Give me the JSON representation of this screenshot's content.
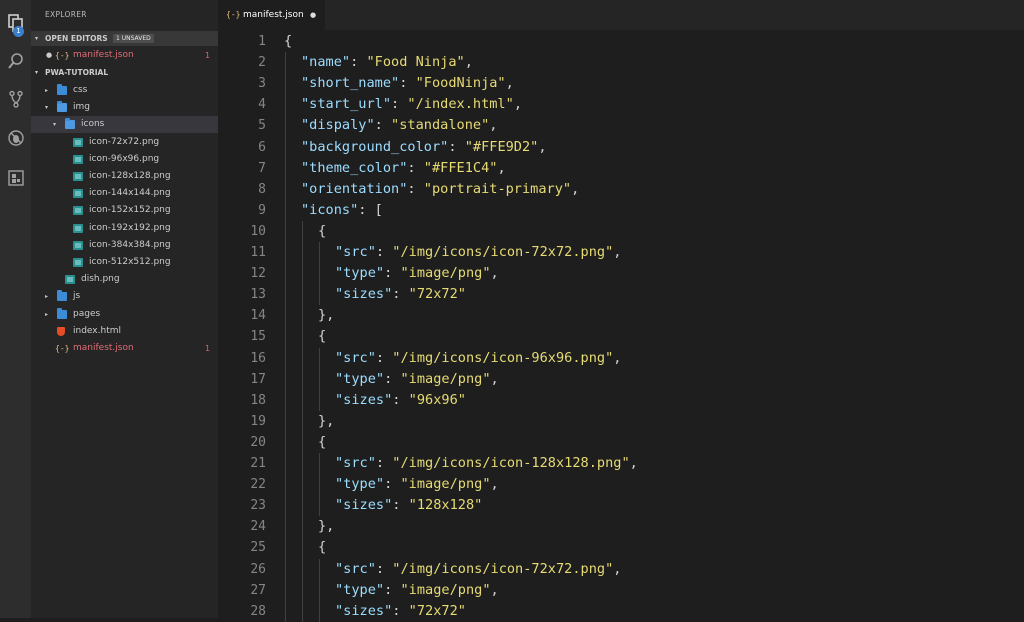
{
  "explorer": {
    "title": "EXPLORER",
    "open_editors": {
      "label": "OPEN EDITORS",
      "badge": "1 UNSAVED",
      "items": [
        {
          "label": "manifest.json",
          "count": "1"
        }
      ]
    },
    "project": {
      "label": "PWA-TUTORIAL",
      "tree": [
        {
          "label": "css",
          "type": "folder",
          "depth": 1,
          "open": false
        },
        {
          "label": "img",
          "type": "folder",
          "depth": 1,
          "open": true
        },
        {
          "label": "icons",
          "type": "folder",
          "depth": 2,
          "open": true,
          "selected": true
        },
        {
          "label": "icon-72x72.png",
          "type": "image",
          "depth": 3
        },
        {
          "label": "icon-96x96.png",
          "type": "image",
          "depth": 3
        },
        {
          "label": "icon-128x128.png",
          "type": "image",
          "depth": 3
        },
        {
          "label": "icon-144x144.png",
          "type": "image",
          "depth": 3
        },
        {
          "label": "icon-152x152.png",
          "type": "image",
          "depth": 3
        },
        {
          "label": "icon-192x192.png",
          "type": "image",
          "depth": 3
        },
        {
          "label": "icon-384x384.png",
          "type": "image",
          "depth": 3
        },
        {
          "label": "icon-512x512.png",
          "type": "image",
          "depth": 3
        },
        {
          "label": "dish.png",
          "type": "image",
          "depth": 2
        },
        {
          "label": "js",
          "type": "folder",
          "depth": 1,
          "open": false
        },
        {
          "label": "pages",
          "type": "folder",
          "depth": 1,
          "open": false
        },
        {
          "label": "index.html",
          "type": "html",
          "depth": 1
        },
        {
          "label": "manifest.json",
          "type": "json",
          "depth": 1,
          "modified": true,
          "count": "1"
        }
      ]
    }
  },
  "activity_bar": {
    "items": [
      "files-icon",
      "search-icon",
      "source-control-icon",
      "debug-icon",
      "extensions-icon"
    ],
    "badge": "1"
  },
  "tab": {
    "label": "manifest.json",
    "icon": "{-}"
  },
  "editor": {
    "line_numbers": [
      "1",
      "2",
      "3",
      "4",
      "5",
      "6",
      "7",
      "8",
      "9",
      "10",
      "11",
      "12",
      "13",
      "14",
      "15",
      "16",
      "17",
      "18",
      "19",
      "20",
      "21",
      "22",
      "23",
      "24",
      "25",
      "26",
      "27",
      "28"
    ],
    "lines": [
      {
        "indent": 0,
        "tokens": [
          {
            "t": "p",
            "v": "{"
          }
        ]
      },
      {
        "indent": 1,
        "tokens": [
          {
            "t": "k",
            "v": "\"name\""
          },
          {
            "t": "p",
            "v": ": "
          },
          {
            "t": "v",
            "v": "\"Food Ninja\""
          },
          {
            "t": "p",
            "v": ","
          }
        ]
      },
      {
        "indent": 1,
        "tokens": [
          {
            "t": "k",
            "v": "\"short_name\""
          },
          {
            "t": "p",
            "v": ": "
          },
          {
            "t": "v",
            "v": "\"FoodNinja\""
          },
          {
            "t": "p",
            "v": ","
          }
        ]
      },
      {
        "indent": 1,
        "tokens": [
          {
            "t": "k",
            "v": "\"start_url\""
          },
          {
            "t": "p",
            "v": ": "
          },
          {
            "t": "v",
            "v": "\"/index.html\""
          },
          {
            "t": "p",
            "v": ","
          }
        ]
      },
      {
        "indent": 1,
        "tokens": [
          {
            "t": "k",
            "v": "\"dispaly\""
          },
          {
            "t": "p",
            "v": ": "
          },
          {
            "t": "v",
            "v": "\"standalone\""
          },
          {
            "t": "p",
            "v": ","
          }
        ]
      },
      {
        "indent": 1,
        "tokens": [
          {
            "t": "k",
            "v": "\"background_color\""
          },
          {
            "t": "p",
            "v": ": "
          },
          {
            "t": "v",
            "v": "\"#FFE9D2\""
          },
          {
            "t": "p",
            "v": ","
          }
        ]
      },
      {
        "indent": 1,
        "tokens": [
          {
            "t": "k",
            "v": "\"theme_color\""
          },
          {
            "t": "p",
            "v": ": "
          },
          {
            "t": "v",
            "v": "\"#FFE1C4\""
          },
          {
            "t": "p",
            "v": ","
          }
        ]
      },
      {
        "indent": 1,
        "tokens": [
          {
            "t": "k",
            "v": "\"orientation\""
          },
          {
            "t": "p",
            "v": ": "
          },
          {
            "t": "v",
            "v": "\"portrait-primary\""
          },
          {
            "t": "p",
            "v": ","
          }
        ]
      },
      {
        "indent": 1,
        "tokens": [
          {
            "t": "k",
            "v": "\"icons\""
          },
          {
            "t": "p",
            "v": ": ["
          }
        ]
      },
      {
        "indent": 2,
        "tokens": [
          {
            "t": "p",
            "v": "{"
          }
        ]
      },
      {
        "indent": 3,
        "tokens": [
          {
            "t": "k",
            "v": "\"src\""
          },
          {
            "t": "p",
            "v": ": "
          },
          {
            "t": "v",
            "v": "\"/img/icons/icon-72x72.png\""
          },
          {
            "t": "p",
            "v": ","
          }
        ]
      },
      {
        "indent": 3,
        "tokens": [
          {
            "t": "k",
            "v": "\"type\""
          },
          {
            "t": "p",
            "v": ": "
          },
          {
            "t": "v",
            "v": "\"image/png\""
          },
          {
            "t": "p",
            "v": ","
          }
        ]
      },
      {
        "indent": 3,
        "tokens": [
          {
            "t": "k",
            "v": "\"sizes\""
          },
          {
            "t": "p",
            "v": ": "
          },
          {
            "t": "v",
            "v": "\"72x72\""
          }
        ]
      },
      {
        "indent": 2,
        "tokens": [
          {
            "t": "p",
            "v": "},"
          }
        ]
      },
      {
        "indent": 2,
        "tokens": [
          {
            "t": "p",
            "v": "{"
          }
        ]
      },
      {
        "indent": 3,
        "tokens": [
          {
            "t": "k",
            "v": "\"src\""
          },
          {
            "t": "p",
            "v": ": "
          },
          {
            "t": "v",
            "v": "\"/img/icons/icon-96x96.png\""
          },
          {
            "t": "p",
            "v": ","
          }
        ]
      },
      {
        "indent": 3,
        "tokens": [
          {
            "t": "k",
            "v": "\"type\""
          },
          {
            "t": "p",
            "v": ": "
          },
          {
            "t": "v",
            "v": "\"image/png\""
          },
          {
            "t": "p",
            "v": ","
          }
        ]
      },
      {
        "indent": 3,
        "tokens": [
          {
            "t": "k",
            "v": "\"sizes\""
          },
          {
            "t": "p",
            "v": ": "
          },
          {
            "t": "v",
            "v": "\"96x96\""
          }
        ]
      },
      {
        "indent": 2,
        "tokens": [
          {
            "t": "p",
            "v": "},"
          }
        ]
      },
      {
        "indent": 2,
        "tokens": [
          {
            "t": "p",
            "v": "{"
          }
        ]
      },
      {
        "indent": 3,
        "tokens": [
          {
            "t": "k",
            "v": "\"src\""
          },
          {
            "t": "p",
            "v": ": "
          },
          {
            "t": "v",
            "v": "\"/img/icons/icon-128x128.png\""
          },
          {
            "t": "p",
            "v": ","
          }
        ]
      },
      {
        "indent": 3,
        "tokens": [
          {
            "t": "k",
            "v": "\"type\""
          },
          {
            "t": "p",
            "v": ": "
          },
          {
            "t": "v",
            "v": "\"image/png\""
          },
          {
            "t": "p",
            "v": ","
          }
        ]
      },
      {
        "indent": 3,
        "tokens": [
          {
            "t": "k",
            "v": "\"sizes\""
          },
          {
            "t": "p",
            "v": ": "
          },
          {
            "t": "v",
            "v": "\"128x128\""
          }
        ]
      },
      {
        "indent": 2,
        "tokens": [
          {
            "t": "p",
            "v": "},"
          }
        ]
      },
      {
        "indent": 2,
        "tokens": [
          {
            "t": "p",
            "v": "{"
          }
        ]
      },
      {
        "indent": 3,
        "tokens": [
          {
            "t": "k",
            "v": "\"src\""
          },
          {
            "t": "p",
            "v": ": "
          },
          {
            "t": "v",
            "v": "\"/img/icons/icon-72x72.png\""
          },
          {
            "t": "p",
            "v": ","
          }
        ]
      },
      {
        "indent": 3,
        "tokens": [
          {
            "t": "k",
            "v": "\"type\""
          },
          {
            "t": "p",
            "v": ": "
          },
          {
            "t": "v",
            "v": "\"image/png\""
          },
          {
            "t": "p",
            "v": ","
          }
        ]
      },
      {
        "indent": 3,
        "tokens": [
          {
            "t": "k",
            "v": "\"sizes\""
          },
          {
            "t": "p",
            "v": ": "
          },
          {
            "t": "v",
            "v": "\"72x72\""
          }
        ]
      }
    ]
  },
  "colors": {
    "key": "#9cdcfe",
    "string_value": "#e6db74",
    "punctuation": "#d4d4d4",
    "modified_file": "#e06c75",
    "folder": "#3c8bd6",
    "image_file": "#2a8f8f"
  }
}
